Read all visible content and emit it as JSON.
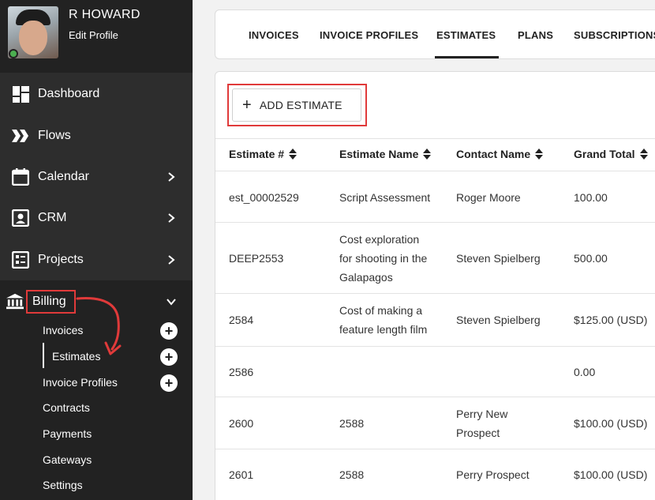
{
  "profile": {
    "name": "R HOWARD",
    "edit_label": "Edit Profile"
  },
  "nav": {
    "dashboard": "Dashboard",
    "flows": "Flows",
    "calendar": "Calendar",
    "crm": "CRM",
    "projects": "Projects",
    "billing": "Billing"
  },
  "billing_menu": {
    "invoices": "Invoices",
    "estimates": "Estimates",
    "invoice_profiles": "Invoice Profiles",
    "contracts": "Contracts",
    "payments": "Payments",
    "gateways": "Gateways",
    "settings": "Settings"
  },
  "tabs": {
    "invoices": "INVOICES",
    "invoice_profiles": "INVOICE PROFILES",
    "estimates": "ESTIMATES",
    "plans": "PLANS",
    "subscriptions": "SUBSCRIPTIONS"
  },
  "toolbar": {
    "add_estimate": "ADD ESTIMATE"
  },
  "table": {
    "headers": [
      "Estimate #",
      "Estimate Name",
      "Contact Name",
      "Grand Total"
    ],
    "rows": [
      {
        "num": "est_00002529",
        "name": [
          "Script Assessment"
        ],
        "contact": [
          "Roger Moore"
        ],
        "total": "100.00"
      },
      {
        "num": "DEEP2553",
        "name": [
          "Cost exploration",
          "for shooting in the",
          "Galapagos"
        ],
        "contact": [
          "Steven Spielberg"
        ],
        "total": "500.00"
      },
      {
        "num": "2584",
        "name": [
          "Cost of making a",
          "feature length film"
        ],
        "contact": [
          "Steven Spielberg"
        ],
        "total": "$125.00 (USD)"
      },
      {
        "num": "2586",
        "name": [
          ""
        ],
        "contact": [
          ""
        ],
        "total": "0.00"
      },
      {
        "num": "2600",
        "name": [
          "2588"
        ],
        "contact": [
          "Perry New",
          "Prospect"
        ],
        "total": "$100.00 (USD)"
      },
      {
        "num": "2601",
        "name": [
          "2588"
        ],
        "contact": [
          "Perry Prospect"
        ],
        "total": "$100.00 (USD)"
      }
    ]
  },
  "colors": {
    "sidebar": "#2d2d2d",
    "highlight": "#e03a3a",
    "online": "#4caf50"
  }
}
